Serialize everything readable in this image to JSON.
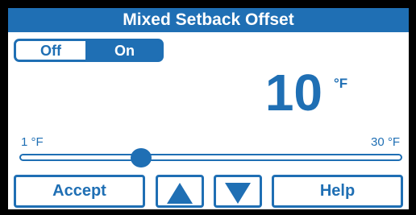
{
  "colors": {
    "accent": "#1f6fb4",
    "background": "#ffffff",
    "bezel": "#000000"
  },
  "header": {
    "title": "Mixed Setback Offset"
  },
  "toggle": {
    "off_label": "Off",
    "on_label": "On",
    "selected": "On"
  },
  "setpoint": {
    "value": "10",
    "unit": "°F"
  },
  "slider": {
    "min_label": "1 °F",
    "max_label": "30 °F",
    "min": 1,
    "max": 30,
    "value": 10
  },
  "buttons": {
    "accept_label": "Accept",
    "help_label": "Help",
    "up_icon": "triangle-up-icon",
    "down_icon": "triangle-down-icon"
  }
}
